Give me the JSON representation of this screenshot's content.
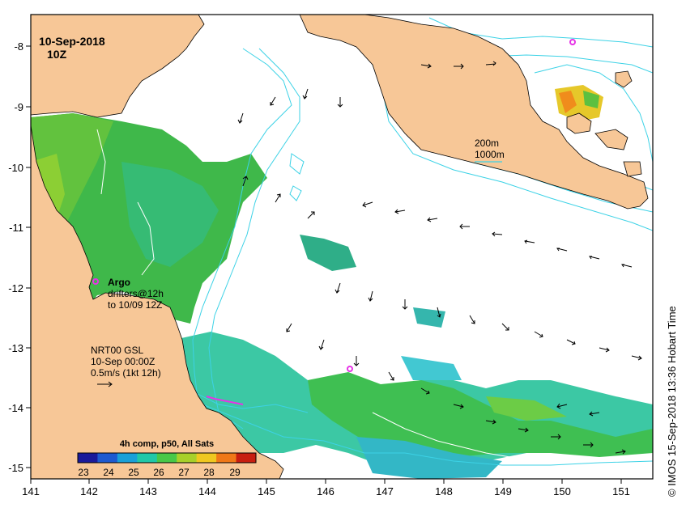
{
  "title": {
    "date": "10-Sep-2018",
    "time": "10Z"
  },
  "credit": "© IMOS 15-Sep-2018 13:36 Hobart Time",
  "axes": {
    "x_ticks": [
      "141",
      "142",
      "143",
      "144",
      "145",
      "146",
      "147",
      "148",
      "149",
      "150",
      "151"
    ],
    "y_ticks": [
      "-8",
      "-9",
      "-10",
      "-11",
      "-12",
      "-13",
      "-14",
      "-15"
    ]
  },
  "bathymetry_legend": {
    "line1": "200m",
    "line2": "1000m",
    "color": "#3cd2e6"
  },
  "argo": {
    "title": "Argo",
    "line1": "drifters@12h",
    "line2": "to 10/09 12Z",
    "color": "#e633e6"
  },
  "current_note": {
    "line1": "NRT00 GSL",
    "line2": "10-Sep 00:00Z",
    "line3": "0.5m/s (1kt 12h)"
  },
  "colorbar": {
    "title": "4h comp, p50, All Sats",
    "labels": [
      "23",
      "24",
      "25",
      "26",
      "27",
      "28",
      "29"
    ],
    "colors": [
      "#1a1a9a",
      "#1e5ad0",
      "#1aa0d8",
      "#20c8a8",
      "#48c848",
      "#a8d02a",
      "#f0c820",
      "#f07818",
      "#c81e10"
    ]
  },
  "colors": {
    "land": "#f7c797",
    "ocean": "#ffffff",
    "sst_green": "#3cbf4a",
    "sst_cyan": "#3cc8b8"
  }
}
